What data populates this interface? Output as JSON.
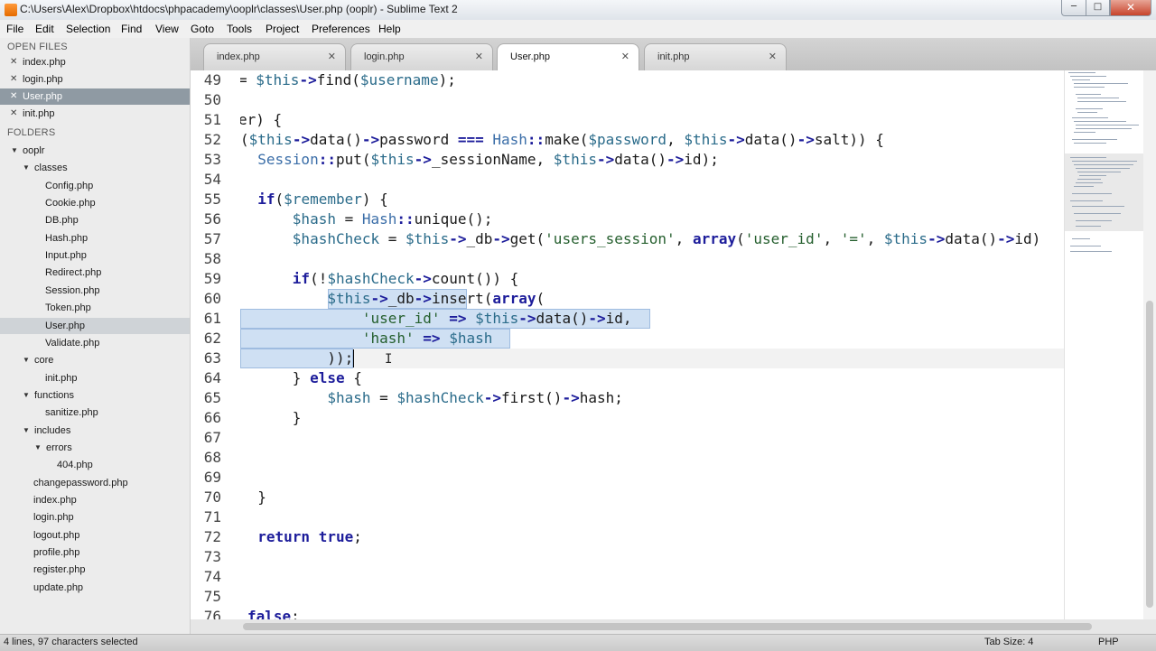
{
  "window": {
    "title": "C:\\Users\\Alex\\Dropbox\\htdocs\\phpacademy\\ooplr\\classes\\User.php (ooplr) - Sublime Text 2",
    "minimize_glyph": "─",
    "maximize_glyph": "□",
    "close_glyph": "✕"
  },
  "menu": [
    "File",
    "Edit",
    "Selection",
    "Find",
    "View",
    "Goto",
    "Tools",
    "Project",
    "Preferences",
    "Help"
  ],
  "sidebar": {
    "open_files_heading": "OPEN FILES",
    "open_files": [
      "index.php",
      "login.php",
      "User.php",
      "init.php"
    ],
    "folders_heading": "FOLDERS",
    "tree": [
      {
        "label": "ooplr",
        "type": "folder",
        "depth": 0
      },
      {
        "label": "classes",
        "type": "folder",
        "depth": 1
      },
      {
        "label": "Config.php",
        "type": "file",
        "depth": 2
      },
      {
        "label": "Cookie.php",
        "type": "file",
        "depth": 2
      },
      {
        "label": "DB.php",
        "type": "file",
        "depth": 2
      },
      {
        "label": "Hash.php",
        "type": "file",
        "depth": 2
      },
      {
        "label": "Input.php",
        "type": "file",
        "depth": 2
      },
      {
        "label": "Redirect.php",
        "type": "file",
        "depth": 2
      },
      {
        "label": "Session.php",
        "type": "file",
        "depth": 2
      },
      {
        "label": "Token.php",
        "type": "file",
        "depth": 2
      },
      {
        "label": "User.php",
        "type": "file",
        "depth": 2
      },
      {
        "label": "Validate.php",
        "type": "file",
        "depth": 2
      },
      {
        "label": "core",
        "type": "folder",
        "depth": 1
      },
      {
        "label": "init.php",
        "type": "file",
        "depth": 2
      },
      {
        "label": "functions",
        "type": "folder",
        "depth": 1
      },
      {
        "label": "sanitize.php",
        "type": "file",
        "depth": 2
      },
      {
        "label": "includes",
        "type": "folder",
        "depth": 1
      },
      {
        "label": "errors",
        "type": "folder",
        "depth": 2
      },
      {
        "label": "404.php",
        "type": "file",
        "depth": 3
      },
      {
        "label": "changepassword.php",
        "type": "file",
        "depth": 1
      },
      {
        "label": "index.php",
        "type": "file",
        "depth": 1
      },
      {
        "label": "login.php",
        "type": "file",
        "depth": 1
      },
      {
        "label": "logout.php",
        "type": "file",
        "depth": 1
      },
      {
        "label": "profile.php",
        "type": "file",
        "depth": 1
      },
      {
        "label": "register.php",
        "type": "file",
        "depth": 1
      },
      {
        "label": "update.php",
        "type": "file",
        "depth": 1
      }
    ]
  },
  "tabs": [
    {
      "label": "index.php",
      "active": false
    },
    {
      "label": "login.php",
      "active": false
    },
    {
      "label": "User.php",
      "active": true
    },
    {
      "label": "init.php",
      "active": false
    }
  ],
  "tab_close_glyph": "✕",
  "editor": {
    "line_numbers": [
      "49",
      "50",
      "51",
      "52",
      "53",
      "54",
      "55",
      "56",
      "57",
      "58",
      "59",
      "60",
      "61",
      "62",
      "63",
      "64",
      "65",
      "66",
      "67",
      "68",
      "69",
      "70",
      "71",
      "72",
      "73",
      "74",
      "75",
      "76"
    ],
    "lines": [
      "= $this->find($username);",
      "",
      "er) {",
      "($this->data()->password === Hash::make($password, $this->data()->salt)) {",
      "  Session::put($this->_sessionName, $this->data()->id);",
      "",
      "  if($remember) {",
      "      $hash = Hash::unique();",
      "      $hashCheck = $this->_db->get('users_session', array('user_id', '=', $this->data()->id)",
      "",
      "      if(!$hashCheck->count()) {",
      "          $this->_db->insert(array(",
      "              'user_id' => $this->data()->id,",
      "              'hash' => $hash",
      "          ));",
      "      } else {",
      "          $hash = $hashCheck->first()->hash;",
      "      }",
      "",
      "",
      "",
      "  }",
      "",
      "  return true;",
      "",
      "",
      "",
      "false;"
    ]
  },
  "statusbar": {
    "selection": "4 lines, 97 characters selected",
    "tab_size": "Tab Size: 4",
    "syntax": "PHP"
  },
  "colors": {
    "selection_fill": "#cfe0f3",
    "selection_border": "#9fbce0",
    "keyword": "#1d1d9b",
    "variable": "#2a6b8a",
    "string": "#255f2e"
  }
}
